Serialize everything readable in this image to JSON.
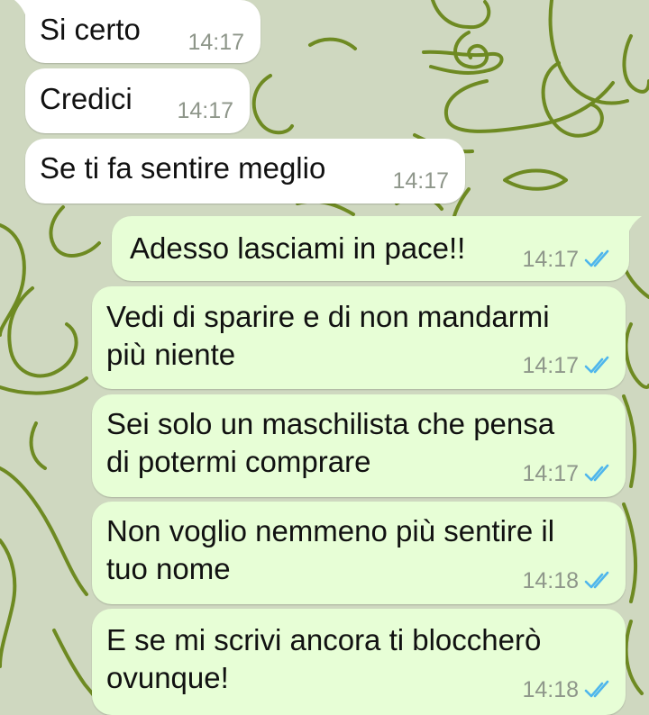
{
  "colors": {
    "wallpaper": "#cfd8c0",
    "wallpaper_line": "#6e8a22",
    "incoming_bubble": "#ffffff",
    "outgoing_bubble": "#e7fed6",
    "message_text": "#111111",
    "timestamp": "#8e968a",
    "read_receipt": "#4fb6ec"
  },
  "messages": [
    {
      "direction": "incoming",
      "text": "Si certo",
      "time": "14:17"
    },
    {
      "direction": "incoming",
      "text": "Credici",
      "time": "14:17"
    },
    {
      "direction": "incoming",
      "text": "Se ti fa sentire meglio",
      "time": "14:17"
    },
    {
      "direction": "outgoing",
      "text": "Adesso lasciami in pace!!",
      "time": "14:17",
      "status_icon": "double-check-read-icon"
    },
    {
      "direction": "outgoing",
      "text": "Vedi di sparire e di non mandarmi\npiù niente",
      "time": "14:17",
      "status_icon": "double-check-read-icon"
    },
    {
      "direction": "outgoing",
      "text": "Sei solo un maschilista che pensa\ndi potermi comprare",
      "time": "14:17",
      "status_icon": "double-check-read-icon"
    },
    {
      "direction": "outgoing",
      "text": "Non voglio nemmeno più sentire il\ntuo nome",
      "time": "14:18",
      "status_icon": "double-check-read-icon"
    },
    {
      "direction": "outgoing",
      "text": "E se mi scrivi ancora ti bloccherò\novunque!",
      "time": "14:18",
      "status_icon": "double-check-read-icon"
    }
  ]
}
